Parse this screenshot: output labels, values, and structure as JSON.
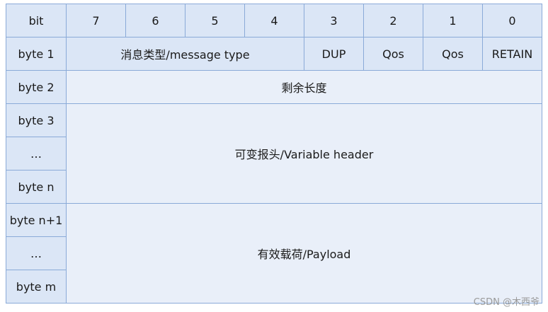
{
  "header": {
    "bit": "bit",
    "bits": [
      "7",
      "6",
      "5",
      "4",
      "3",
      "2",
      "1",
      "0"
    ]
  },
  "rows": {
    "byte1": {
      "label": "byte 1",
      "message_type": "消息类型/message type",
      "dup": "DUP",
      "qos_a": "Qos",
      "qos_b": "Qos",
      "retain": "RETAIN"
    },
    "byte2": {
      "label": "byte 2",
      "remaining_length": "剩余长度"
    },
    "variable": {
      "labels": [
        "byte 3",
        "…",
        "byte n"
      ],
      "content": "可变报头/Variable header"
    },
    "payload": {
      "labels": [
        "byte n+1",
        "…",
        "byte m"
      ],
      "content": "有效载荷/Payload"
    }
  },
  "watermark": "CSDN @木西爷"
}
